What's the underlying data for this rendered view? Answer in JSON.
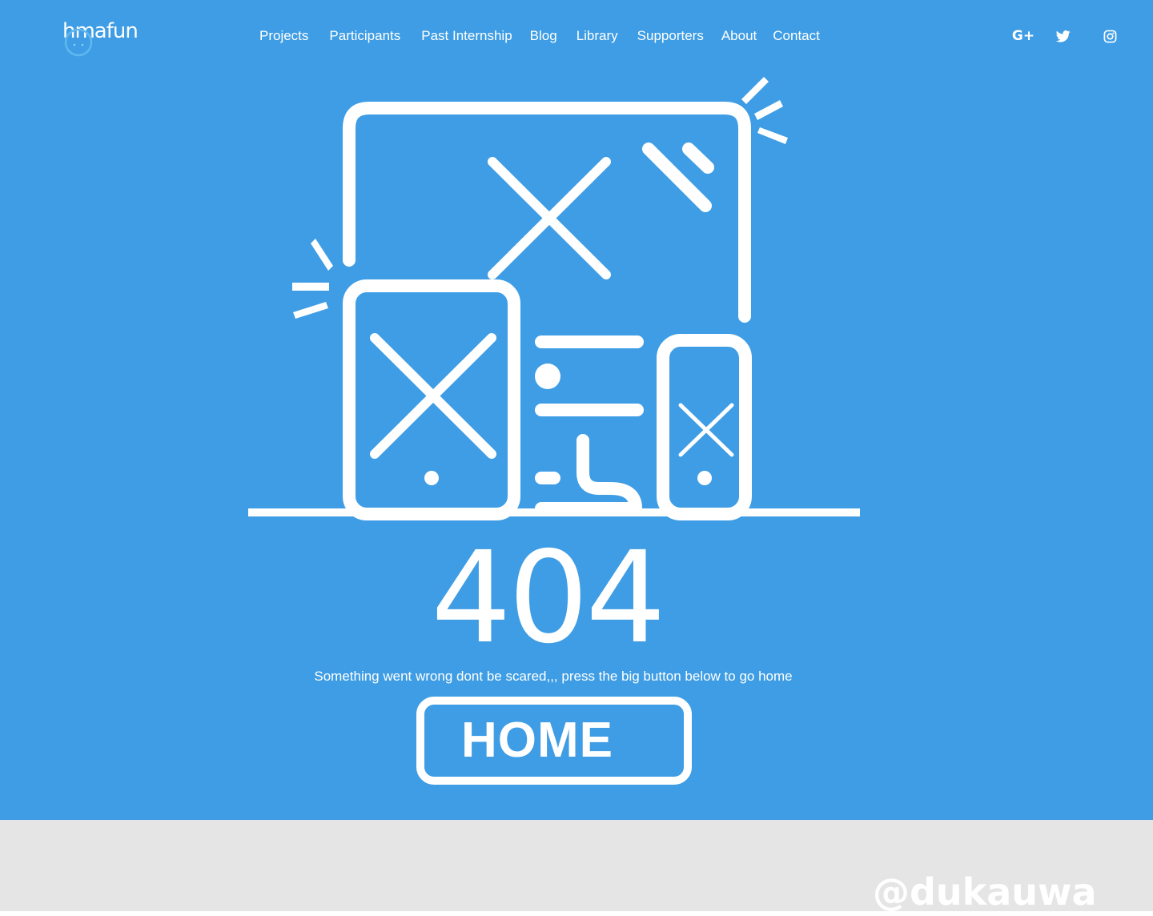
{
  "header": {
    "logo_text": "hmafun",
    "nav": [
      {
        "label": "Projects"
      },
      {
        "label": "Participants"
      },
      {
        "label": "Past Internship"
      },
      {
        "label": "Blog"
      },
      {
        "label": "Library"
      },
      {
        "label": "Supporters"
      },
      {
        "label": "About"
      },
      {
        "label": "Contact"
      }
    ],
    "social": [
      {
        "icon": "google-plus-icon",
        "glyph": "G+"
      },
      {
        "icon": "twitter-icon"
      },
      {
        "icon": "instagram-icon"
      }
    ]
  },
  "main": {
    "illustration_icon": "broken-devices-icon",
    "error_code": "404",
    "message": "Something went wrong dont be scared,,, press the big button below to go home",
    "home_button_label": "HOME"
  },
  "watermark": "@dukauwa",
  "colors": {
    "hero_background": "#3e9de4",
    "footer_background": "#e5e5e5",
    "foreground": "#ffffff"
  }
}
